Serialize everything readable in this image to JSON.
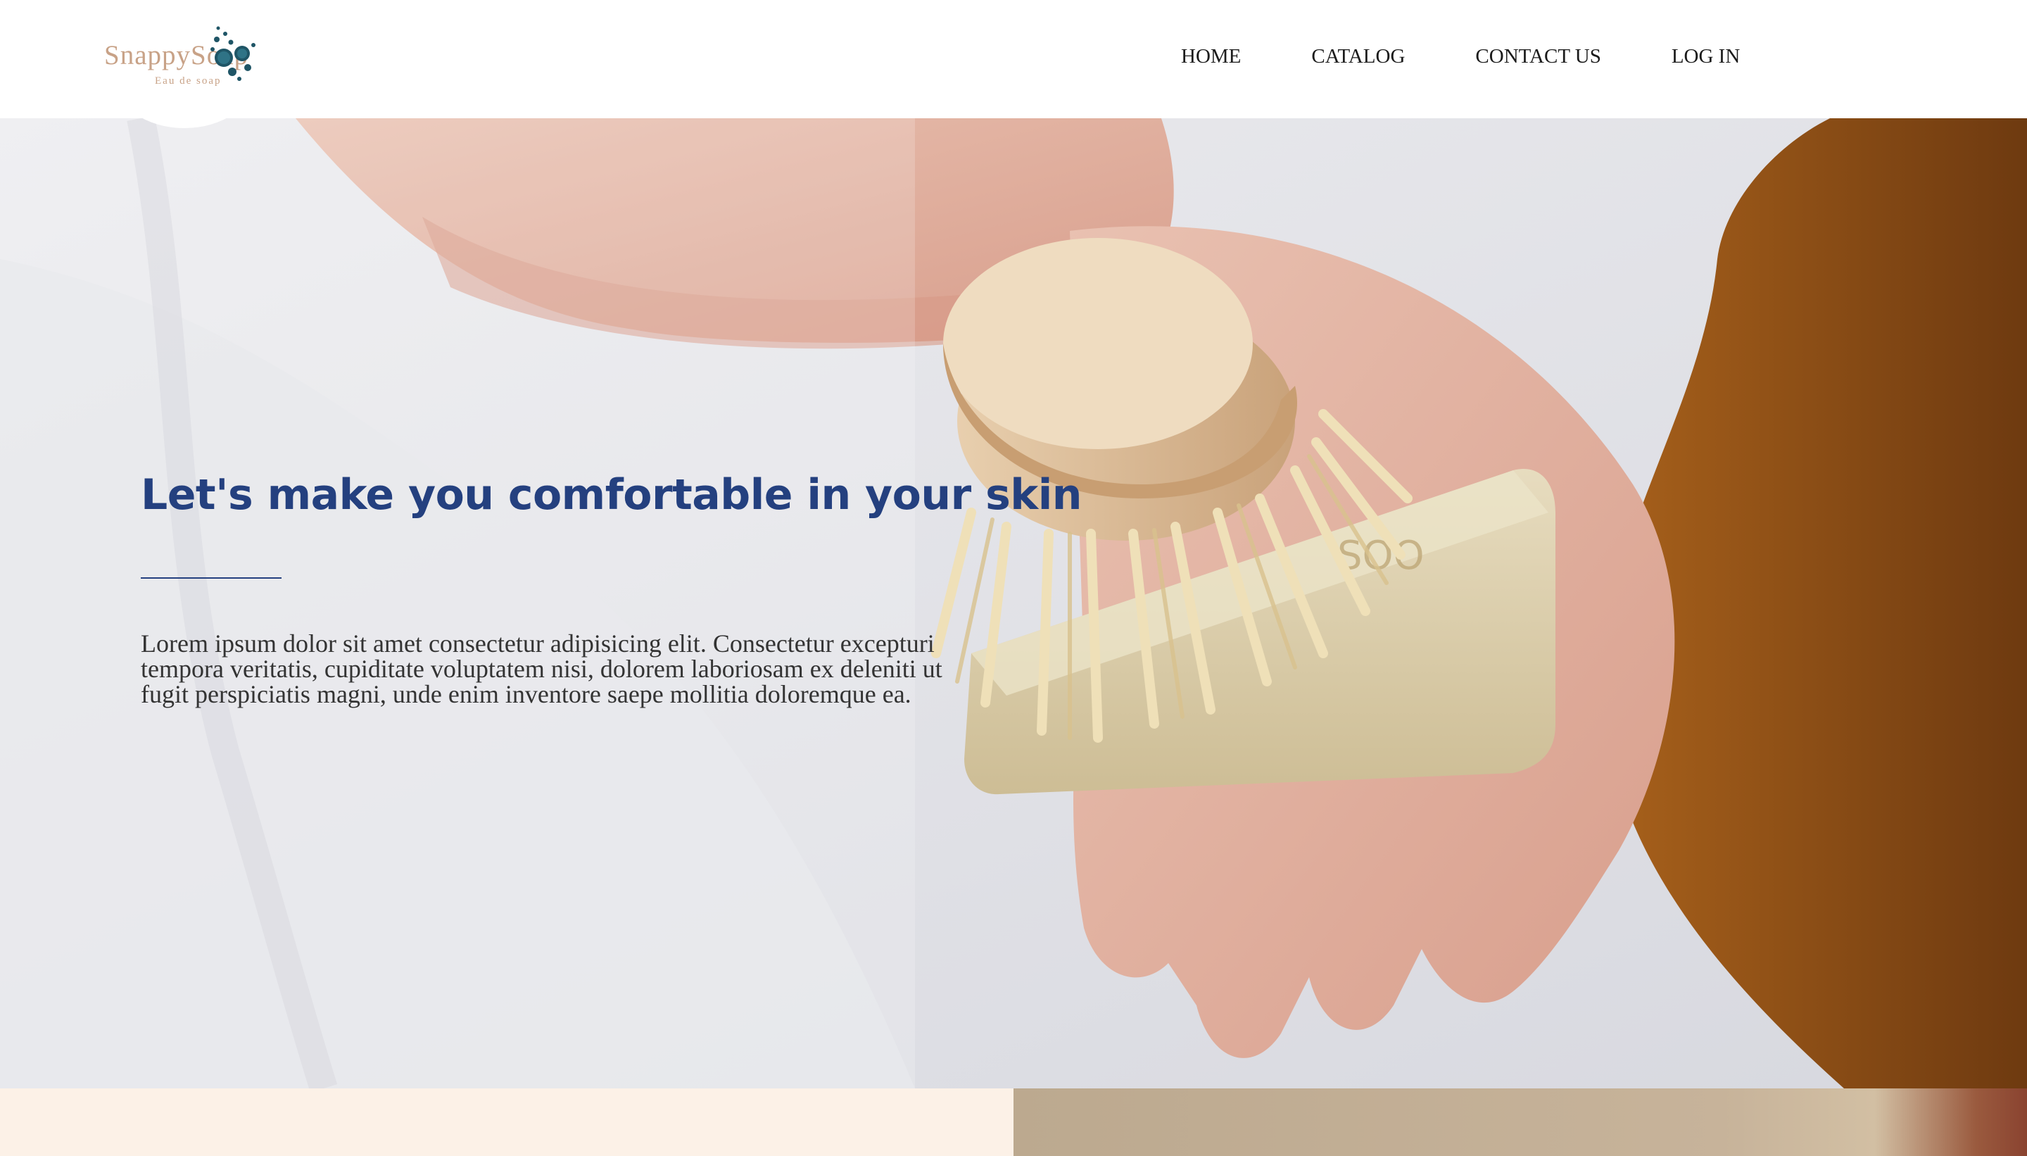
{
  "brand": {
    "name": "SnappySoap",
    "tagline": "Eau de soap",
    "colors": {
      "logo": "#c8a287",
      "bubbles": "#1f5566",
      "headline": "#24407f",
      "body_text": "#333333",
      "cream_panel": "#fcf1e7"
    }
  },
  "nav": {
    "items": [
      {
        "label": "HOME"
      },
      {
        "label": "CATALOG"
      },
      {
        "label": "CONTACT US"
      },
      {
        "label": "LOG IN"
      }
    ]
  },
  "hero": {
    "title": "Let's make you comfortable in your skin",
    "body": "Lorem ipsum dolor sit amet consectetur adipisicing elit. Consectetur excepturi tempora veritatis, cupiditate voluptatem nisi, dolorem laboriosam ex deleniti ut fugit perspiciatis magni, unde enim inventore saepe mollitia doloremque ea.",
    "image_subject": "hands holding a natural soap bar and a wooden bristle brush"
  }
}
